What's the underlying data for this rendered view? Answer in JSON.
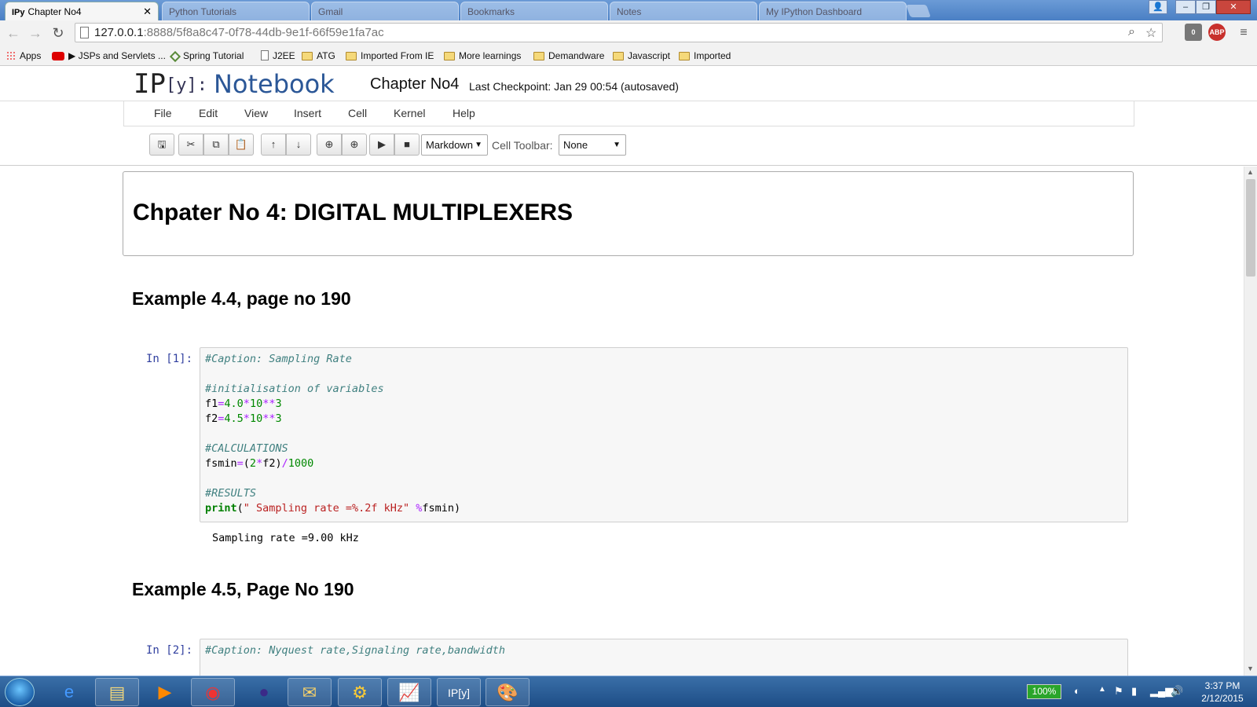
{
  "browser": {
    "active_tab": {
      "favicon_text": "IPy",
      "title": "Chapter No4"
    },
    "background_tabs": [
      "Python Tutorials",
      "Gmail",
      "Bookmarks",
      "Notes",
      "My IPython Dashboard"
    ],
    "url_host": "127.0.0.1",
    "url_rest": ":8888/5f8a8c47-0f78-44db-9e1f-66f59e1fa7ac",
    "extension_badge": "0",
    "adblock_label": "ABP",
    "bookmarks": [
      {
        "label": "Apps",
        "icon": "apps-icon"
      },
      {
        "label": "▶ JSPs and Servlets ...",
        "icon": "youtube-icon"
      },
      {
        "label": "Spring Tutorial",
        "icon": "spring-icon"
      },
      {
        "label": "J2EE",
        "icon": "page-icon"
      },
      {
        "label": "ATG",
        "icon": "folder-icon"
      },
      {
        "label": "Imported From IE",
        "icon": "folder-icon"
      },
      {
        "label": "More learnings",
        "icon": "folder-icon"
      },
      {
        "label": "Demandware",
        "icon": "folder-icon"
      },
      {
        "label": "Javascript",
        "icon": "folder-icon"
      },
      {
        "label": "Imported",
        "icon": "folder-icon"
      }
    ]
  },
  "notebook": {
    "logo_ip": "IP",
    "logo_y": "[y]:",
    "logo_word": "Notebook",
    "title": "Chapter No4",
    "checkpoint": "Last Checkpoint: Jan 29 00:54 (autosaved)",
    "menu": [
      "File",
      "Edit",
      "View",
      "Insert",
      "Cell",
      "Kernel",
      "Help"
    ],
    "cell_type": "Markdown",
    "cell_toolbar_label": "Cell Toolbar:",
    "cell_toolbar_value": "None"
  },
  "cells": {
    "chapter_heading": "Chpater No 4: DIGITAL MULTIPLEXERS",
    "ex1_heading": "Example 4.4, page no 190",
    "ex1_prompt": "In [1]:",
    "ex1_output": "Sampling rate =9.00 kHz",
    "ex2_heading": "Example 4.5, Page No 190",
    "ex2_prompt": "In [2]:",
    "ex2_first_line": "#Caption: Nyquest rate,Signaling rate,bandwidth"
  },
  "taskbar": {
    "battery": "100%",
    "time": "3:37 PM",
    "date": "2/12/2015"
  }
}
